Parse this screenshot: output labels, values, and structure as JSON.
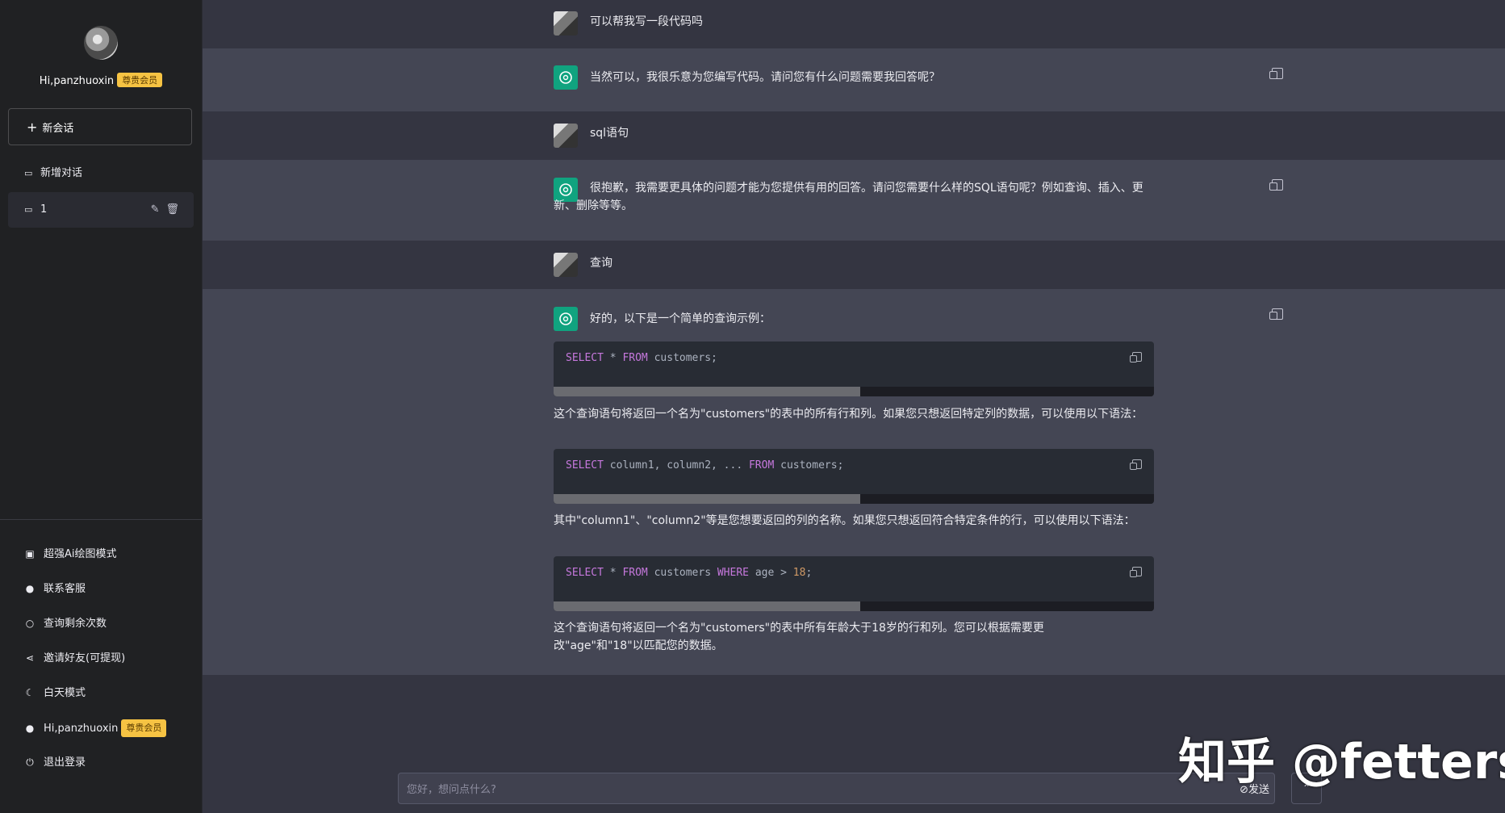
{
  "sidebar": {
    "user_greeting": "Hi,panzhuoxin",
    "vip_badge": "尊贵会员",
    "new_chat_label": "新会话",
    "conversations": [
      {
        "label": "新增对话"
      },
      {
        "label": "1"
      }
    ],
    "menu": [
      {
        "label": "超强Ai绘图模式",
        "icon": "image-icon"
      },
      {
        "label": "联系客服",
        "icon": "wechat-icon"
      },
      {
        "label": "查询剩余次数",
        "icon": "search-icon"
      },
      {
        "label": "邀请好友(可提现)",
        "icon": "share-icon"
      },
      {
        "label": "白天模式",
        "icon": "moon-icon"
      },
      {
        "label": "Hi,panzhuoxin",
        "icon": "user-icon",
        "badge": "尊贵会员"
      },
      {
        "label": "退出登录",
        "icon": "power-icon"
      }
    ]
  },
  "chat": {
    "messages": [
      {
        "role": "user",
        "text": "可以帮我写一段代码吗"
      },
      {
        "role": "bot",
        "text": "当然可以，我很乐意为您编写代码。请问您有什么问题需要我回答呢？"
      },
      {
        "role": "user",
        "text": "sql语句"
      },
      {
        "role": "bot",
        "text": "很抱歉，我需要更具体的问题才能为您提供有用的回答。请问您需要什么样的SQL语句呢？例如查询、插入、更新、删除等等。"
      },
      {
        "role": "user",
        "text": "查询"
      },
      {
        "role": "bot",
        "text": "好的，以下是一个简单的查询示例："
      }
    ],
    "code1": {
      "kw1": "SELECT",
      "p1": " * ",
      "kw2": "FROM",
      "p2": " customers;"
    },
    "para1": "这个查询语句将返回一个名为\"customers\"的表中的所有行和列。如果您只想返回特定列的数据，可以使用以下语法：",
    "code2": {
      "kw1": "SELECT",
      "p1": " column1, column2, ... ",
      "kw2": "FROM",
      "p2": " customers;"
    },
    "para2": "其中\"column1\"、\"column2\"等是您想要返回的列的名称。如果您只想返回符合特定条件的行，可以使用以下语法：",
    "code3": {
      "kw1": "SELECT",
      "p1": " * ",
      "kw2": "FROM",
      "p2": " customers ",
      "kw3": "WHERE",
      "p3": " age > ",
      "num": "18",
      "p4": ";"
    },
    "para3": "这个查询语句将返回一个名为\"customers\"的表中所有年龄大于18岁的行和列。您可以根据需要更改\"age\"和\"18\"以匹配您的数据。"
  },
  "input": {
    "placeholder": "您好，想问点什么?",
    "send_label": "发送",
    "scroll_up": "⌃"
  },
  "watermark": "知乎 @fetters"
}
